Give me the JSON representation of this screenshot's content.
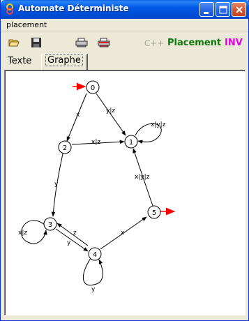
{
  "window": {
    "title": "Automate Déterministe",
    "minimize_icon": "minimize-icon",
    "maximize_icon": "maximize-icon",
    "close_icon": "close-icon"
  },
  "menu": {
    "items": [
      {
        "label": "placement"
      }
    ]
  },
  "toolbar": {
    "open_icon": "folder-open-icon",
    "save_icon": "floppy-disk-icon",
    "print_icon": "printer-icon",
    "print2_icon": "printer-red-icon",
    "cpp_label": "C++",
    "placement_label": "Placement",
    "inv_label": "INV",
    "colors": {
      "cpp": "#a8a8a0",
      "placement": "#0a7a0a",
      "inv": "#e000e0"
    }
  },
  "tabs": [
    {
      "label": "Texte",
      "active": false
    },
    {
      "label": "Graphe",
      "active": true
    }
  ],
  "automaton": {
    "initial_marker_color": "#ff0000",
    "final_marker_color": "#ff0000",
    "states": [
      {
        "id": "0",
        "label": "0"
      },
      {
        "id": "1",
        "label": "1"
      },
      {
        "id": "2",
        "label": "2"
      },
      {
        "id": "3",
        "label": "3"
      },
      {
        "id": "4",
        "label": "4"
      },
      {
        "id": "5",
        "label": "5"
      }
    ],
    "initial_state": "0",
    "final_states": [
      "5"
    ],
    "transitions": [
      {
        "from": "0",
        "to": "2",
        "label": "x"
      },
      {
        "from": "0",
        "to": "1",
        "label": "y|z"
      },
      {
        "from": "2",
        "to": "1",
        "label": "x|z"
      },
      {
        "from": "1",
        "to": "1",
        "label": "x|y|z"
      },
      {
        "from": "2",
        "to": "3",
        "label": "y"
      },
      {
        "from": "3",
        "to": "3",
        "label": "x|z"
      },
      {
        "from": "3",
        "to": "4",
        "label": "y"
      },
      {
        "from": "4",
        "to": "3",
        "label": "z"
      },
      {
        "from": "4",
        "to": "5",
        "label": "x"
      },
      {
        "from": "5",
        "to": "1",
        "label": "x|y|z"
      },
      {
        "from": "4",
        "to": "4",
        "label": "y"
      }
    ]
  }
}
